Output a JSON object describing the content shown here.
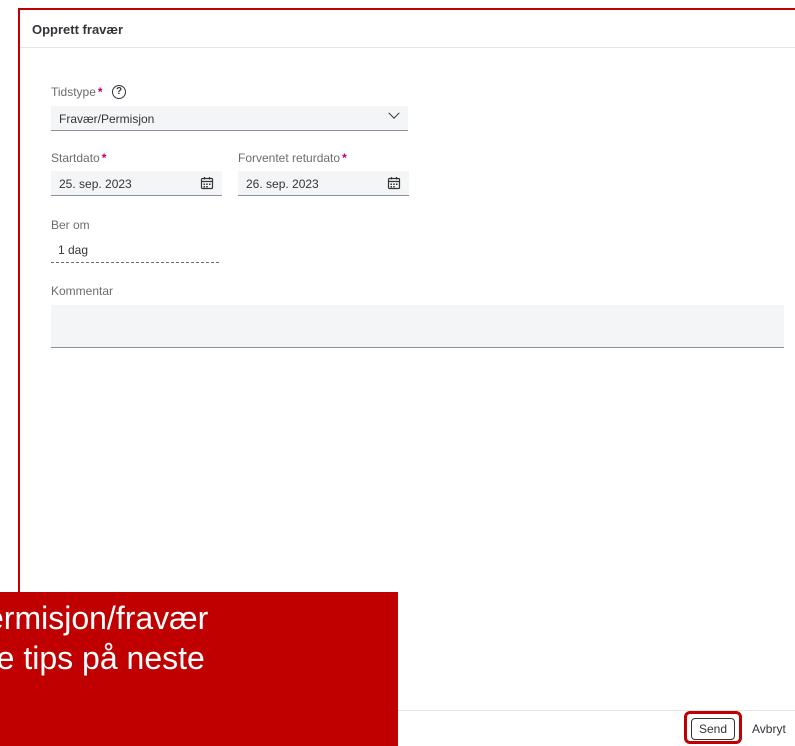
{
  "dialog": {
    "title": "Opprett fravær"
  },
  "form": {
    "time_type": {
      "label": "Tidstype",
      "required_mark": "*",
      "help_glyph": "?",
      "value": "Fravær/Permisjon"
    },
    "start_date": {
      "label": "Startdato",
      "required_mark": "*",
      "value": "25. sep. 2023"
    },
    "expected_return": {
      "label": "Forventet returdato",
      "required_mark": "*",
      "value": "26. sep. 2023"
    },
    "requests": {
      "label": "Ber om",
      "value": "1 dag"
    },
    "comment": {
      "label": "Kommentar",
      "value": ""
    }
  },
  "footer": {
    "send_label": "Send",
    "cancel_label": "Avbryt"
  },
  "overlay": {
    "line1": "ermisjon/fravær",
    "line2": "re tips på neste"
  },
  "colors": {
    "accent_red": "#c00000",
    "required_star": "#bb0066",
    "field_bg": "#f4f5f6"
  }
}
